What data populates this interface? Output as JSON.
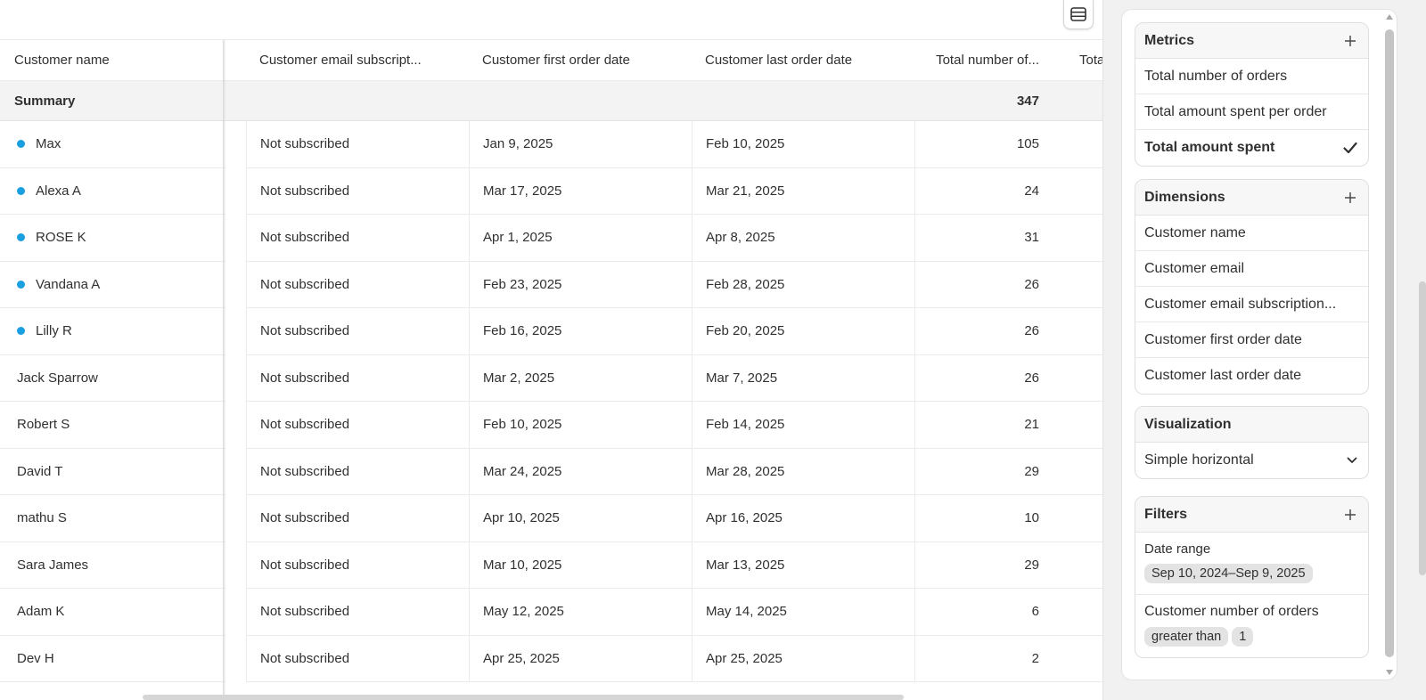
{
  "table": {
    "headers": {
      "name": "Customer name",
      "email_sub": "Customer email subscript...",
      "first": "Customer first order date",
      "last": "Customer last order date",
      "total": "Total number of...",
      "total2": "Tota"
    },
    "summary": {
      "label": "Summary",
      "total": "347"
    },
    "rows": [
      {
        "name": "Max",
        "dot": true,
        "email_sub": "Not subscribed",
        "first": "Jan 9, 2025",
        "last": "Feb 10, 2025",
        "total": "105"
      },
      {
        "name": "Alexa A",
        "dot": true,
        "email_sub": "Not subscribed",
        "first": "Mar 17, 2025",
        "last": "Mar 21, 2025",
        "total": "24"
      },
      {
        "name": "ROSE K",
        "dot": true,
        "email_sub": "Not subscribed",
        "first": "Apr 1, 2025",
        "last": "Apr 8, 2025",
        "total": "31"
      },
      {
        "name": "Vandana A",
        "dot": true,
        "email_sub": "Not subscribed",
        "first": "Feb 23, 2025",
        "last": "Feb 28, 2025",
        "total": "26"
      },
      {
        "name": "Lilly R",
        "dot": true,
        "email_sub": "Not subscribed",
        "first": "Feb 16, 2025",
        "last": "Feb 20, 2025",
        "total": "26"
      },
      {
        "name": "Jack Sparrow",
        "dot": false,
        "email_sub": "Not subscribed",
        "first": "Mar 2, 2025",
        "last": "Mar 7, 2025",
        "total": "26"
      },
      {
        "name": "Robert S",
        "dot": false,
        "email_sub": "Not subscribed",
        "first": "Feb 10, 2025",
        "last": "Feb 14, 2025",
        "total": "21"
      },
      {
        "name": "David T",
        "dot": false,
        "email_sub": "Not subscribed",
        "first": "Mar 24, 2025",
        "last": "Mar 28, 2025",
        "total": "29"
      },
      {
        "name": "mathu S",
        "dot": false,
        "email_sub": "Not subscribed",
        "first": "Apr 10, 2025",
        "last": "Apr 16, 2025",
        "total": "10"
      },
      {
        "name": "Sara James",
        "dot": false,
        "email_sub": "Not subscribed",
        "first": "Mar 10, 2025",
        "last": "Mar 13, 2025",
        "total": "29"
      },
      {
        "name": "Adam K",
        "dot": false,
        "email_sub": "Not subscribed",
        "first": "May 12, 2025",
        "last": "May 14, 2025",
        "total": "6"
      },
      {
        "name": "Dev H",
        "dot": false,
        "email_sub": "Not subscribed",
        "first": "Apr 25, 2025",
        "last": "Apr 25, 2025",
        "total": "2"
      }
    ]
  },
  "panel": {
    "metrics": {
      "title": "Metrics",
      "items": [
        "Total number of orders",
        "Total amount spent per order",
        "Total amount spent"
      ],
      "selected_index": 2
    },
    "dimensions": {
      "title": "Dimensions",
      "items": [
        "Customer name",
        "Customer email",
        "Customer email subscription...",
        "Customer first order date",
        "Customer last order date"
      ]
    },
    "visualization": {
      "title": "Visualization",
      "value": "Simple horizontal"
    },
    "filters": {
      "title": "Filters",
      "date_range_label": "Date range",
      "date_range_value": "Sep 10, 2024–Sep 9, 2025",
      "orders_label": "Customer number of orders",
      "orders_operator": "greater than",
      "orders_value": "1"
    }
  },
  "icons": {
    "table_settings": "table-settings-icon",
    "plus": "plus-icon",
    "check": "checkmark-icon",
    "chevron": "chevron-down-icon"
  },
  "colors": {
    "dot": "#1a9fe0",
    "summary_bg": "#f3f3f3"
  }
}
